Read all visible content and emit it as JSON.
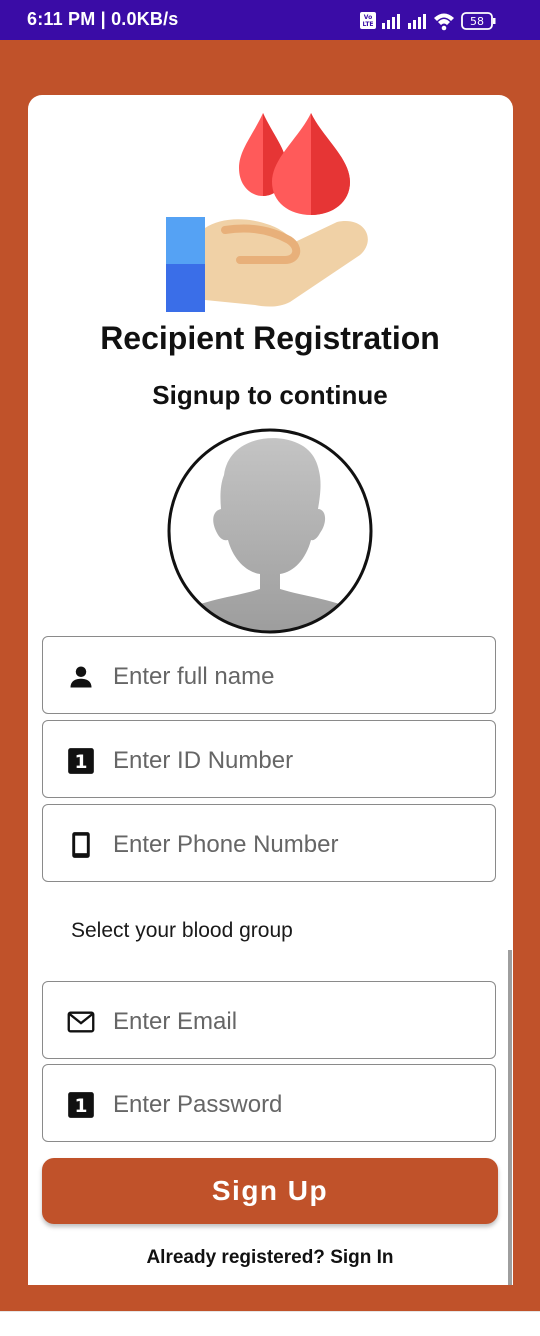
{
  "status_bar": {
    "time": "6:11 PM | 0.0KB/s",
    "volte": "Vo\nLTE",
    "battery": "58"
  },
  "header": {
    "title": "Recipient Registration",
    "subtitle": "Signup to continue"
  },
  "form": {
    "full_name_placeholder": "Enter full name",
    "id_number_placeholder": "Enter ID Number",
    "id_icon_glyph": "1",
    "phone_placeholder": "Enter Phone Number",
    "blood_group_label": "Select your blood group",
    "email_placeholder": "Enter Email",
    "password_placeholder": "Enter Password",
    "password_icon_glyph": "1"
  },
  "actions": {
    "signup_label": "Sign Up",
    "signin_link": "Already registered? Sign In"
  },
  "colors": {
    "status_bar": "#3a0ca6",
    "accent": "#c0522a",
    "card": "#ffffff"
  }
}
